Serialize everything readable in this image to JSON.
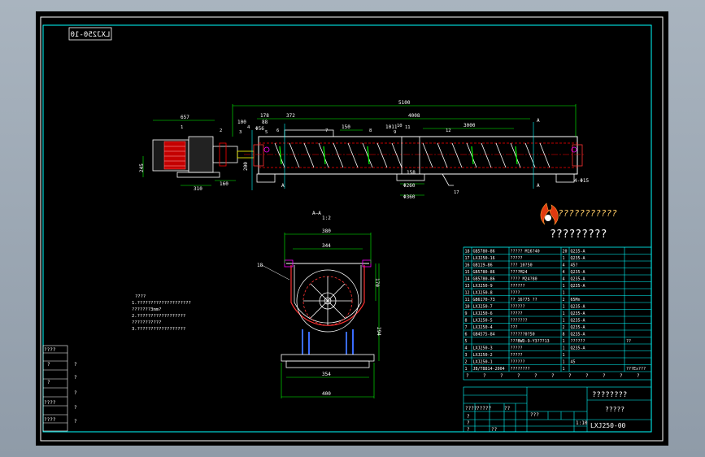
{
  "drawing": {
    "stamp": "LXJ250-10",
    "dims_top": {
      "total": "5100",
      "d657": "657",
      "d178": "178",
      "d372": "372",
      "d4008": "4008",
      "d3000": "3000",
      "d150": "150",
      "d100": "100",
      "d88": "88",
      "d856": "Φ56",
      "d1011": "1011",
      "d245": "245",
      "d310": "310",
      "d160": "160",
      "d200": "200",
      "d260": "Φ260",
      "d360": "Φ360",
      "d158": "158",
      "d114": "4-Φ15",
      "sec_a": "A"
    },
    "parts_top": [
      "1",
      "2",
      "3",
      "4",
      "5",
      "6",
      "7",
      "8",
      "9",
      "10",
      "11",
      "12",
      "13",
      "14",
      "15",
      "16",
      "17"
    ],
    "section_label": "A—A",
    "section_scale": "1:2",
    "dims_side": {
      "w380": "380",
      "w344": "344",
      "h170": "170",
      "h294": "294",
      "w354": "354",
      "w400": "400",
      "p18": "18"
    },
    "notes": [
      "????",
      "1.????????????????????",
      "  ???????3mm?",
      "2.??????????????????",
      "  ???????????",
      "3.??????????????????"
    ],
    "logo_text": "???????????",
    "logo_title": "?????????",
    "bom": [
      {
        "no": "18",
        "code": "GB5780-86",
        "name": "????? M16?40",
        "qty": "20",
        "mat": "Q235-A"
      },
      {
        "no": "17",
        "code": "LXJ250-16",
        "name": "?????",
        "qty": "1",
        "mat": "Q235-A"
      },
      {
        "no": "16",
        "code": "GB119-86",
        "name": "???  10?50",
        "qty": "4",
        "mat": "45?"
      },
      {
        "no": "15",
        "code": "GB5780-86",
        "name": "????M24",
        "qty": "4",
        "mat": "Q235-A"
      },
      {
        "no": "14",
        "code": "GB5780-86",
        "name": "????  M24?80",
        "qty": "4",
        "mat": "Q235-A"
      },
      {
        "no": "13",
        "code": "LXJ250-9",
        "name": "??????",
        "qty": "1",
        "mat": "Q235-A"
      },
      {
        "no": "12",
        "code": "LXJ250-8",
        "name": "????",
        "qty": "1",
        "mat": ""
      },
      {
        "no": "11",
        "code": "GB6170-73",
        "name": "??  16?75  ??",
        "qty": "2",
        "mat": "65Mn"
      },
      {
        "no": "10",
        "code": "LXJ250-7",
        "name": "??????",
        "qty": "1",
        "mat": "Q235-A"
      },
      {
        "no": "9",
        "code": "LXJ250-6",
        "name": "?????",
        "qty": "1",
        "mat": "Q235-A"
      },
      {
        "no": "8",
        "code": "LXJ250-5",
        "name": "???????",
        "qty": "1",
        "mat": "Q235-A"
      },
      {
        "no": "7",
        "code": "LXJ250-4",
        "name": "???",
        "qty": "2",
        "mat": "Q235-A"
      },
      {
        "no": "6",
        "code": "GB4575-84",
        "name": "??????0?50",
        "qty": "8",
        "mat": "Q235-A"
      },
      {
        "no": "5",
        "code": "",
        "name": "???BWD-9-Y3?7?13",
        "qty": "1",
        "mat": "??????"
      },
      {
        "no": "4",
        "code": "LXJ250-3",
        "name": "?????",
        "qty": "1",
        "mat": "Q235-A"
      },
      {
        "no": "3",
        "code": "LXJ250-2",
        "name": "?????",
        "qty": "1",
        "mat": ""
      },
      {
        "no": "2",
        "code": "LXJ250-1",
        "name": "??????",
        "qty": "1",
        "mat": "45"
      },
      {
        "no": "1",
        "code": "JB/T8814-2004",
        "name": "????????",
        "qty": "1",
        "mat": ""
      }
    ],
    "bom_extra": {
      "row5_note": "??",
      "row1_note": "???Ex???"
    },
    "title_block": {
      "header_cols": [
        "?",
        "?",
        "?",
        "?",
        "?",
        "?",
        "?",
        "?",
        "?",
        "?",
        "?"
      ],
      "title": "????????",
      "subtitle": "?????",
      "drawing_no": "LXJ250-00",
      "scale": "1:10",
      "row_labels": [
        "????",
        "?????",
        "??",
        "???",
        "?",
        "?",
        "?",
        "??"
      ]
    },
    "left_strip": [
      "????",
      "?",
      "?",
      "?",
      "?",
      "????",
      "?",
      "?",
      "????",
      "?",
      "?"
    ]
  }
}
